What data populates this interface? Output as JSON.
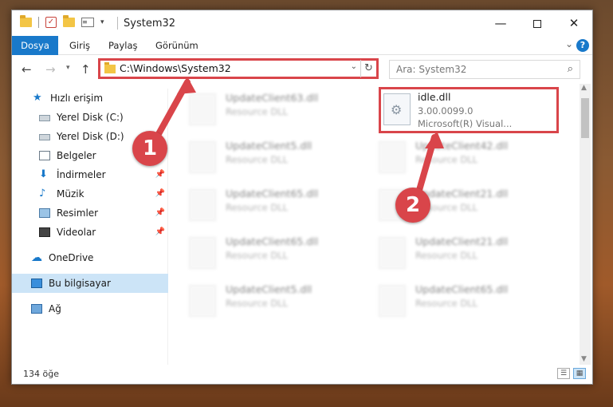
{
  "titlebar": {
    "title": "System32"
  },
  "ribbon": {
    "tabs": [
      "Dosya",
      "Giriş",
      "Paylaş",
      "Görünüm"
    ]
  },
  "navbar": {
    "address": "C:\\Windows\\System32",
    "search_placeholder": "Ara: System32"
  },
  "sidebar": {
    "items": [
      {
        "label": "Hızlı erişim",
        "icon": "star-icon"
      },
      {
        "label": "Yerel Disk (C:)",
        "icon": "drive-icon"
      },
      {
        "label": "Yerel Disk (D:)",
        "icon": "drive-icon"
      },
      {
        "label": "Belgeler",
        "icon": "document-icon"
      },
      {
        "label": "İndirmeler",
        "icon": "download-icon"
      },
      {
        "label": "Müzik",
        "icon": "music-icon"
      },
      {
        "label": "Resimler",
        "icon": "pictures-icon"
      },
      {
        "label": "Videolar",
        "icon": "video-icon"
      },
      {
        "label": "OneDrive",
        "icon": "cloud-icon"
      },
      {
        "label": "Bu bilgisayar",
        "icon": "computer-icon"
      },
      {
        "label": "Ağ",
        "icon": "network-icon"
      }
    ]
  },
  "files": {
    "highlighted": {
      "name": "idle.dll",
      "version": "3.00.0099.0",
      "company": "Microsoft(R) Visual..."
    },
    "left_column": [
      {
        "name": "UpdateClient63.dll",
        "type": "Resource DLL"
      },
      {
        "name": "UpdateClient5.dll",
        "type": "Resource DLL"
      },
      {
        "name": "UpdateClient65.dll",
        "type": "Resource DLL"
      },
      {
        "name": "UpdateClient65.dll",
        "type": "Resource DLL"
      },
      {
        "name": "UpdateClient5.dll",
        "type": "Resource DLL"
      }
    ],
    "right_column": [
      {
        "name": "UpdateClient42.dll",
        "type": "Resource DLL"
      },
      {
        "name": "UpdateClient21.dll",
        "type": "Resource DLL"
      },
      {
        "name": "UpdateClient21.dll",
        "type": "Resource DLL"
      },
      {
        "name": "UpdateClient65.dll",
        "type": "Resource DLL"
      }
    ]
  },
  "statusbar": {
    "count": "134 öğe"
  },
  "callouts": [
    "1",
    "2"
  ],
  "colors": {
    "accent": "#1979ca",
    "highlight_red": "#d9454a",
    "selected_bg": "#cce4f7"
  }
}
